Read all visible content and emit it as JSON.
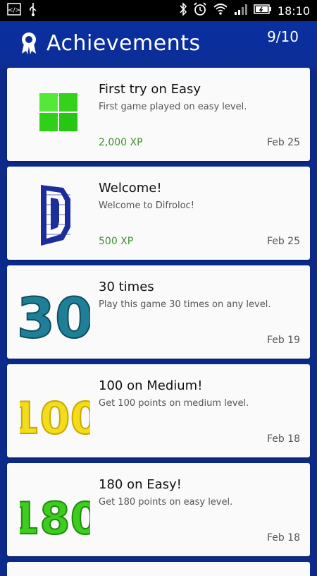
{
  "status_bar": {
    "time": "18:10",
    "icons": [
      "code-icon",
      "usb-icon",
      "bluetooth-icon",
      "alarm-icon",
      "wifi-icon",
      "signal-icon",
      "battery-icon"
    ]
  },
  "header": {
    "title": "Achievements",
    "icon": "award-ribbon-icon",
    "progress_label": "9/10",
    "progress_fraction": 0.9
  },
  "achievements": [
    {
      "title": "First try on Easy",
      "description": "First game played on easy level.",
      "xp": "2,000 XP",
      "date": "Feb 25",
      "icon": "green-block-icon"
    },
    {
      "title": "Welcome!",
      "description": "Welcome to Difroloc!",
      "xp": "500 XP",
      "date": "Feb 25",
      "icon": "pixel-d-icon"
    },
    {
      "title": "30 times",
      "description": "Play this game 30 times on any level.",
      "xp": "",
      "date": "Feb 19",
      "icon": "pixel-30-icon"
    },
    {
      "title": "100 on Medium!",
      "description": "Get 100 points on medium level.",
      "xp": "",
      "date": "Feb 18",
      "icon": "pixel-100-icon"
    },
    {
      "title": "180 on Easy!",
      "description": "Get 180 points on easy level.",
      "xp": "",
      "date": "Feb 18",
      "icon": "pixel-180-icon"
    }
  ],
  "colors": {
    "background": "#0b2a8a",
    "xp_green": "#3f8f32",
    "progress_green": "#43b04a",
    "icon_teal": "#1e7f96",
    "icon_yellow": "#f2dc1b",
    "icon_green": "#3ccd1e"
  }
}
